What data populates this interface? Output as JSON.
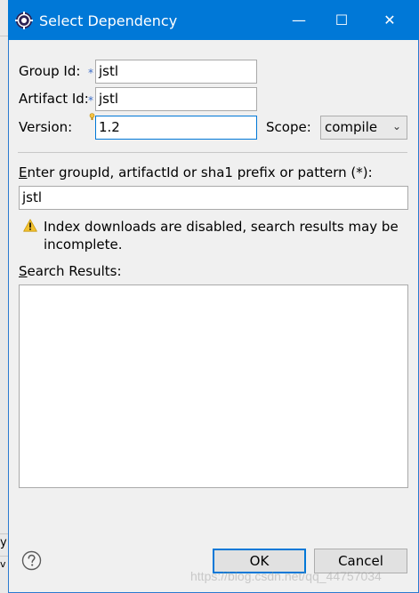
{
  "window": {
    "title": "Select Dependency",
    "controls": {
      "minimize": "—",
      "maximize": "☐",
      "close": "✕"
    }
  },
  "form": {
    "group_id_label": "Group Id:",
    "group_id_value": "jstl",
    "artifact_id_label": "Artifact Id:",
    "artifact_id_value": "jstl",
    "version_label": "Version:",
    "version_value": "1.2",
    "scope_label": "Scope:",
    "scope_value": "compile",
    "required_marker": "*"
  },
  "search": {
    "prompt_first": "E",
    "prompt_rest": "nter groupId, artifactId or sha1 prefix or pattern (*):",
    "query": "jstl",
    "warning_line1": "Index downloads are disabled, search results may be",
    "warning_line2": "incomplete.",
    "results_label_first": "S",
    "results_label_rest": "earch Results:"
  },
  "buttons": {
    "ok": "OK",
    "cancel": "Cancel"
  },
  "background": {
    "left_text_1": "y",
    "left_text_2": "v"
  },
  "watermark": "https://blog.csdn.net/qq_44757034",
  "colors": {
    "titlebar": "#0078d7",
    "focus_border": "#0078d7",
    "warning": "#f2c12e"
  }
}
